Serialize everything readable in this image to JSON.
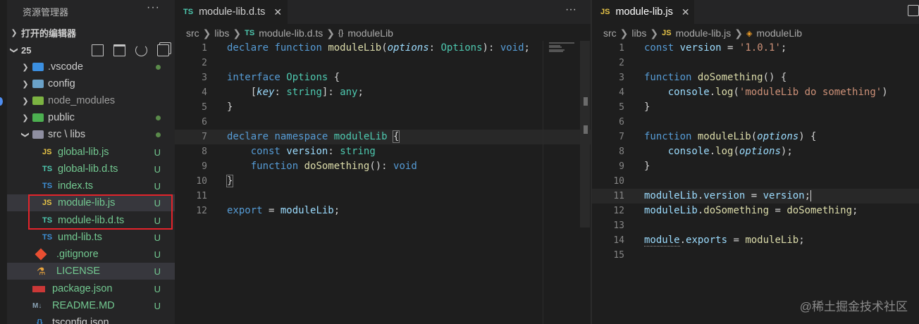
{
  "explorer": {
    "title": "资源管理器",
    "more": "···",
    "open_editors": "打开的编辑器",
    "workspace": "25",
    "tree": [
      {
        "name": ".vscode",
        "icon": "vscode-folder-icon",
        "indicator": "dot",
        "expanded": false
      },
      {
        "name": "config",
        "icon": "config-folder-icon",
        "indicator": "",
        "expanded": false
      },
      {
        "name": "node_modules",
        "icon": "node-folder-icon",
        "indicator": "",
        "expanded": false
      },
      {
        "name": "public",
        "icon": "public-folder-icon",
        "indicator": "dot",
        "expanded": false
      },
      {
        "name": "src \\ libs",
        "icon": "src-folder-icon",
        "indicator": "dot",
        "expanded": true
      },
      {
        "name": "global-lib.js",
        "kind": "JS",
        "status": "U"
      },
      {
        "name": "global-lib.d.ts",
        "kind": "TS",
        "status": "U"
      },
      {
        "name": "index.ts",
        "kind": "TS",
        "status": "U"
      },
      {
        "name": "module-lib.js",
        "kind": "JS",
        "status": "U"
      },
      {
        "name": "module-lib.d.ts",
        "kind": "TS",
        "status": "U"
      },
      {
        "name": "umd-lib.ts",
        "kind": "TS",
        "status": "U"
      },
      {
        "name": ".gitignore",
        "kind": "git",
        "status": "U"
      },
      {
        "name": "LICENSE",
        "kind": "license",
        "status": "U"
      },
      {
        "name": "package.json",
        "kind": "npm",
        "status": "U"
      },
      {
        "name": "README.MD",
        "kind": "md",
        "status": "U"
      },
      {
        "name": "tsconfig.json",
        "kind": "json",
        "status": ""
      }
    ]
  },
  "editor_left": {
    "tab": {
      "icon": "TS",
      "label": "module-lib.d.ts"
    },
    "more": "···",
    "breadcrumb": [
      "src",
      "libs",
      "module-lib.d.ts",
      "moduleLib"
    ],
    "breadcrumb_icon_ts": "TS",
    "breadcrumb_icon_ns": "{}",
    "lines": [
      {
        "n": "1"
      },
      {
        "n": "2"
      },
      {
        "n": "3"
      },
      {
        "n": "4"
      },
      {
        "n": "5"
      },
      {
        "n": "6"
      },
      {
        "n": "7"
      },
      {
        "n": "8"
      },
      {
        "n": "9"
      },
      {
        "n": "10"
      },
      {
        "n": "11"
      },
      {
        "n": "12"
      }
    ]
  },
  "editor_right": {
    "tab": {
      "icon": "JS",
      "label": "module-lib.js"
    },
    "breadcrumb": [
      "src",
      "libs",
      "module-lib.js",
      "moduleLib"
    ],
    "breadcrumb_icon_js": "JS",
    "lines": [
      {
        "n": "1"
      },
      {
        "n": "2"
      },
      {
        "n": "3"
      },
      {
        "n": "4"
      },
      {
        "n": "5"
      },
      {
        "n": "6"
      },
      {
        "n": "7"
      },
      {
        "n": "8"
      },
      {
        "n": "9"
      },
      {
        "n": "10"
      },
      {
        "n": "11"
      },
      {
        "n": "12"
      },
      {
        "n": "13"
      },
      {
        "n": "14"
      },
      {
        "n": "15"
      }
    ]
  },
  "watermark": "@稀土掘金技术社区",
  "colors": {
    "accent": "#007acc",
    "untracked": "#73c991",
    "highlight_box": "#e3242b"
  }
}
